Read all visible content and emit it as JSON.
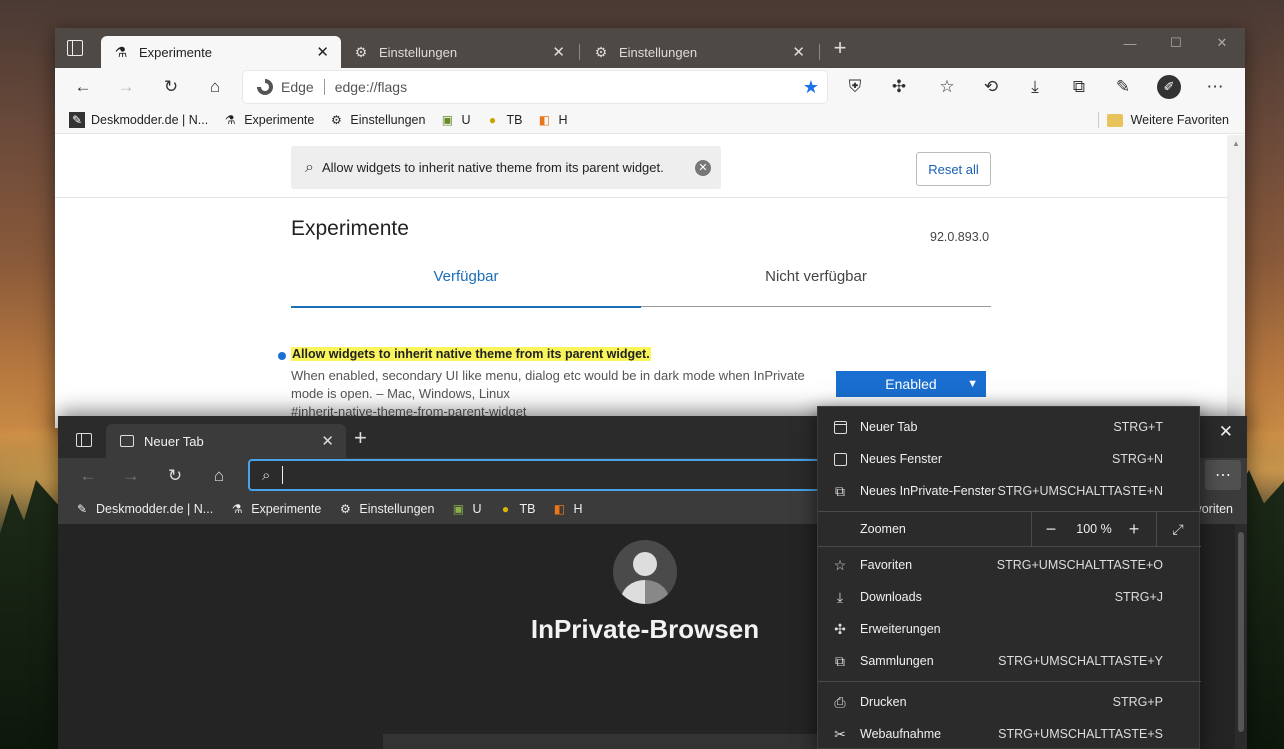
{
  "window1": {
    "tabs": [
      {
        "title": "Experimente",
        "icon": "flask-icon"
      },
      {
        "title": "Einstellungen",
        "icon": "gear-icon"
      },
      {
        "title": "Einstellungen",
        "icon": "gear-icon"
      }
    ],
    "address": {
      "brand": "Edge",
      "url": "edge://flags"
    },
    "favorites": [
      {
        "label": "Deskmodder.de | N...",
        "icon": "pen-icon"
      },
      {
        "label": "Experimente",
        "icon": "flask-icon"
      },
      {
        "label": "Einstellungen",
        "icon": "gear-icon"
      },
      {
        "label": "U",
        "icon": "bookmark-u-icon"
      },
      {
        "label": "TB",
        "icon": "bookmark-tb-icon"
      },
      {
        "label": "H",
        "icon": "bookmark-h-icon"
      }
    ],
    "favorites_more": "Weitere Favoriten",
    "flags_page": {
      "search_value": "Allow widgets to inherit native theme from its parent widget.",
      "reset_label": "Reset all",
      "title": "Experimente",
      "version": "92.0.893.0",
      "tab_available": "Verfügbar",
      "tab_unavailable": "Nicht verfügbar",
      "flag_name": "Allow widgets to inherit native theme from its parent widget.",
      "flag_desc_line1": "When enabled, secondary UI like menu, dialog etc would be in dark mode when InPrivate",
      "flag_desc_line2": "mode is open. – Mac, Windows, Linux",
      "flag_link": "#inherit-native-theme-from-parent-widget",
      "flag_state": "Enabled"
    }
  },
  "window2": {
    "tab_title": "Neuer Tab",
    "favorites": [
      {
        "label": "Deskmodder.de | N...",
        "icon": "pen-icon"
      },
      {
        "label": "Experimente",
        "icon": "flask-icon"
      },
      {
        "label": "Einstellungen",
        "icon": "gear-icon"
      },
      {
        "label": "U",
        "icon": "bookmark-u-icon"
      },
      {
        "label": "TB",
        "icon": "bookmark-tb-icon"
      },
      {
        "label": "H",
        "icon": "bookmark-h-icon"
      }
    ],
    "favorites_right_partial": "vorit",
    "favorites_right_suffix": "en",
    "inprivate_title": "InPrivate-Browsen"
  },
  "menu": {
    "items": [
      {
        "label": "Neuer Tab",
        "shortcut": "STRG+T",
        "icon": "new-tab-icon"
      },
      {
        "label": "Neues Fenster",
        "shortcut": "STRG+N",
        "icon": "new-window-icon"
      },
      {
        "label": "Neues InPrivate-Fenster",
        "shortcut": "STRG+UMSCHALTTASTE+N",
        "icon": "inprivate-window-icon"
      }
    ],
    "zoom_label": "Zoomen",
    "zoom_value": "100 %",
    "items2": [
      {
        "label": "Favoriten",
        "shortcut": "STRG+UMSCHALTTASTE+O",
        "icon": "favorites-icon"
      },
      {
        "label": "Downloads",
        "shortcut": "STRG+J",
        "icon": "download-icon"
      },
      {
        "label": "Erweiterungen",
        "shortcut": "",
        "icon": "extensions-icon"
      },
      {
        "label": "Sammlungen",
        "shortcut": "STRG+UMSCHALTTASTE+Y",
        "icon": "collections-icon"
      }
    ],
    "items3": [
      {
        "label": "Drucken",
        "shortcut": "STRG+P",
        "icon": "print-icon"
      },
      {
        "label": "Webaufnahme",
        "shortcut": "STRG+UMSCHALTTASTE+S",
        "icon": "web-capture-icon"
      }
    ]
  },
  "colors": {
    "accent": "#1a6fd0",
    "highlight": "#f9f55a",
    "dark_bg": "#202020"
  }
}
